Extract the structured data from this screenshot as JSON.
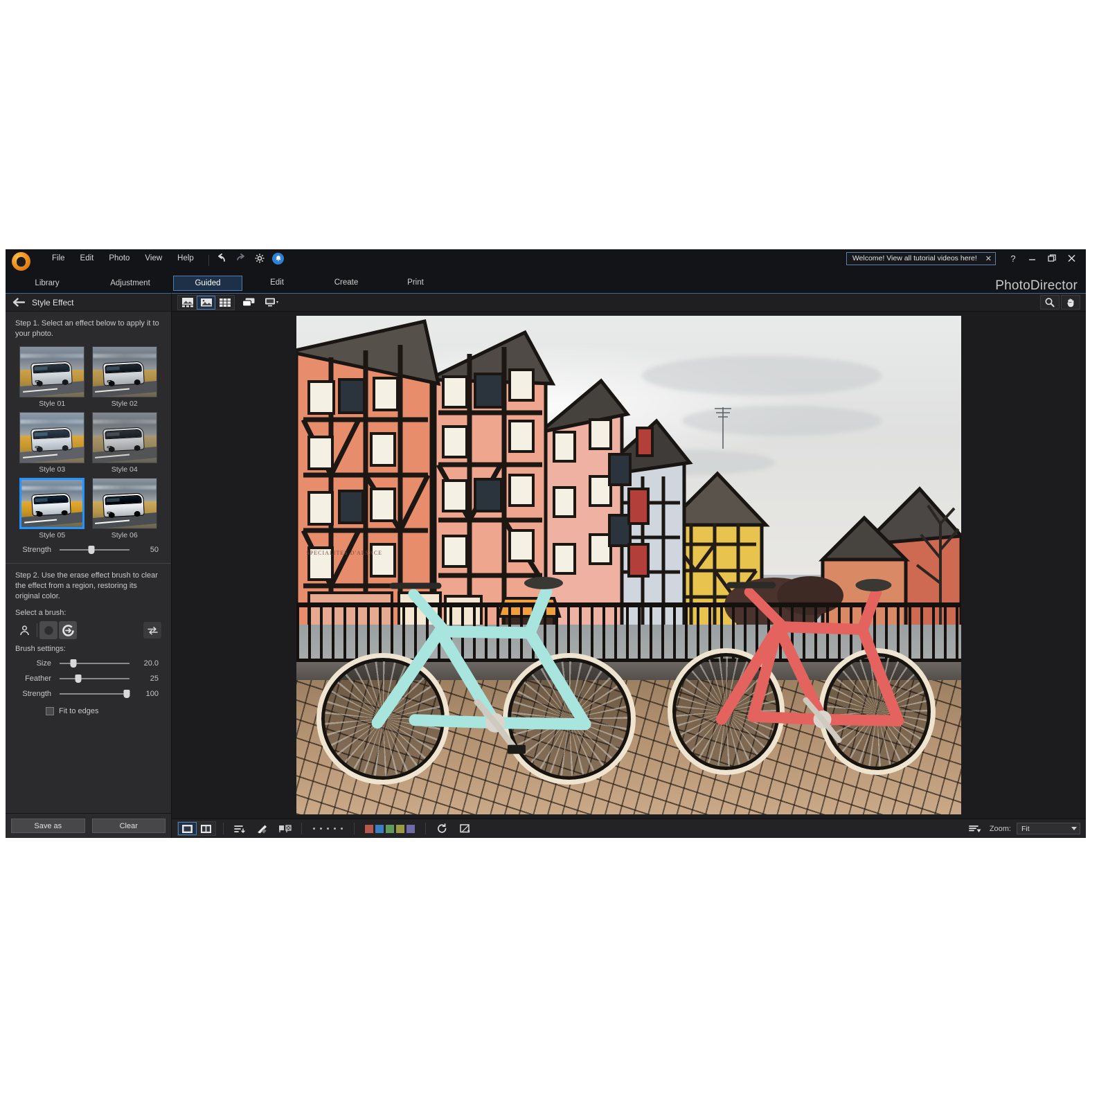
{
  "app": {
    "brand": "PhotoDirector",
    "logo_icon": "photodirector-logo-icon"
  },
  "menubar": {
    "items": [
      {
        "label": "File"
      },
      {
        "label": "Edit"
      },
      {
        "label": "Photo"
      },
      {
        "label": "View"
      },
      {
        "label": "Help"
      }
    ],
    "tools": [
      {
        "name": "undo-icon",
        "glyph": "↶"
      },
      {
        "name": "redo-icon",
        "glyph": "↷"
      },
      {
        "name": "gear-icon",
        "glyph": "✷"
      },
      {
        "name": "notification-icon",
        "glyph": "♠"
      }
    ]
  },
  "tutorial_banner": {
    "text": "Welcome! View all tutorial videos here!",
    "close_label": "✕"
  },
  "window_controls": {
    "help": "?",
    "minimize": "—",
    "restore": "❐",
    "close": "✕"
  },
  "modules": {
    "left_tabs": [
      {
        "label": "Library"
      },
      {
        "label": "Adjustment"
      }
    ],
    "right_tabs": [
      {
        "label": "Guided",
        "active": true
      },
      {
        "label": "Edit",
        "active": false
      },
      {
        "label": "Create",
        "active": false
      },
      {
        "label": "Print",
        "active": false
      }
    ]
  },
  "left_panel": {
    "back_icon": "back-arrow-icon",
    "title": "Style Effect",
    "step1_text": "Step 1. Select an effect below to apply it to your photo.",
    "styles": [
      {
        "label": "Style 01",
        "selected": false
      },
      {
        "label": "Style 02",
        "selected": false
      },
      {
        "label": "Style 03",
        "selected": false
      },
      {
        "label": "Style 04",
        "selected": false
      },
      {
        "label": "Style 05",
        "selected": true
      },
      {
        "label": "Style 06",
        "selected": false
      }
    ],
    "strength_slider": {
      "label": "Strength",
      "value": "50",
      "percent": 50
    },
    "step2_text": "Step 2. Use the erase effect brush to clear the effect from a region, restoring its original color.",
    "brush_section_label": "Select a brush:",
    "brushes": [
      {
        "name": "person-brush-icon",
        "active": false
      },
      {
        "name": "circle-brush-icon",
        "active": true
      },
      {
        "name": "erase-effect-brush-icon",
        "active": true
      }
    ],
    "invert_button": {
      "name": "invert-mask-icon"
    },
    "brush_settings_label": "Brush settings:",
    "brush_settings": [
      {
        "label": "Size",
        "value": "20.0",
        "percent": 20
      },
      {
        "label": "Feather",
        "value": "25",
        "percent": 25
      },
      {
        "label": "Strength",
        "value": "100",
        "percent": 97
      }
    ],
    "fit_to_edges": {
      "label": "Fit to edges",
      "checked": false
    },
    "footer": {
      "save_as": "Save as",
      "clear": "Clear"
    }
  },
  "viewer_toolbar": {
    "view_modes": [
      {
        "name": "browser-view-icon",
        "active": false
      },
      {
        "name": "photo-view-icon",
        "active": true
      },
      {
        "name": "grid-view-icon",
        "active": false
      }
    ],
    "compare_icon": "compare-windows-icon",
    "display_icon": "second-monitor-icon",
    "zoom_tool_icon": "magnifier-icon",
    "hand_tool_icon": "hand-icon"
  },
  "photo": {
    "alt": "Stylized painting of Alsatian half-timbered houses along a canal with a mint bicycle and a red bicycle leaning on an iron railing over cobblestones",
    "shop_sign": "SPECIALITES D'ALSACE"
  },
  "bottom_bar": {
    "view_buttons": [
      {
        "name": "single-view-icon",
        "active": true
      },
      {
        "name": "split-view-icon",
        "active": false
      }
    ],
    "icons": [
      {
        "name": "sort-order-icon"
      },
      {
        "name": "pencil-edit-icon"
      },
      {
        "name": "flag-rating-icon"
      }
    ],
    "rating_dots": 5,
    "color_labels": [
      "#b8584c",
      "#3a7fc4",
      "#5f9a5a",
      "#9a9a45",
      "#6f6aa8"
    ],
    "rotate_icon": "rotate-icon",
    "crop_icon": "crop-icon",
    "list_options_icon": "list-options-icon",
    "zoom": {
      "label": "Zoom:",
      "value": "Fit"
    }
  }
}
